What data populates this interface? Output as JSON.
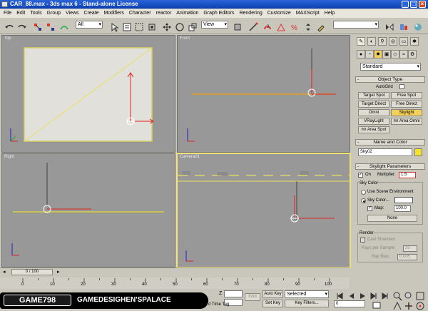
{
  "window": {
    "title": "CAR_88.max - 3ds max 6 - Stand-alone License"
  },
  "menubar": [
    "File",
    "Edit",
    "Tools",
    "Group",
    "Views",
    "Create",
    "Modifiers",
    "Character",
    "reactor",
    "Animation",
    "Graph Editors",
    "Rendering",
    "Customize",
    "MAXScript",
    "Help"
  ],
  "toolbar": {
    "selection_filter": "All",
    "reference_coord": "View"
  },
  "viewports": {
    "top": "Top",
    "front": "Front",
    "left": "Right",
    "camera": "Camera01"
  },
  "panel": {
    "category": "Standard",
    "object_type": {
      "header": "Object Type",
      "autogrid": "AutoGrid",
      "buttons": [
        "Target Spot",
        "Free Spot",
        "Target Direct",
        "Free Direct",
        "Omni",
        "Skylight",
        "VRayLight",
        "mr Area Omni",
        "mr Area Spot"
      ],
      "active": "Skylight"
    },
    "name_color": {
      "header": "Name and Color",
      "name": "Sky02"
    },
    "skylight": {
      "header": "Skylight Parameters",
      "on_label": "On",
      "multiplier_label": "Multiplier:",
      "multiplier": "1.5",
      "sky_color_group": "Sky Color",
      "use_scene_env": "Use Scene Environment",
      "sky_color": "Sky Color...",
      "map_label": "Map:",
      "map_value": "100.0",
      "map_button": "None",
      "render_group": "Render",
      "cast_shadows": "Cast Shadows",
      "rays_label": "Rays per Sample:",
      "rays_value": "20",
      "raybias_label": "Ray Bias:",
      "raybias_value": "0.005"
    }
  },
  "timeline": {
    "frame": "0 / 100",
    "ticks": [
      "0",
      "10",
      "20",
      "30",
      "40",
      "50",
      "60",
      "70",
      "80",
      "90",
      "100"
    ]
  },
  "statusbar": {
    "z_label": "Z",
    "grid_button": "Grid",
    "add_time_tag": "d Time Tag",
    "autokey": "Auto Key",
    "setkey": "Set Key",
    "selected": "Selected",
    "key_filters": "Key Filters...",
    "frame_value": "0"
  },
  "banner": {
    "left": "GAME798",
    "right": "GAMEDESIGHEN'SPALACE"
  },
  "colors": {
    "active_button": "#f3d05a",
    "viewport_bg": "#989898",
    "active_border": "#f0e27a",
    "swatch": "#f7e12a"
  }
}
